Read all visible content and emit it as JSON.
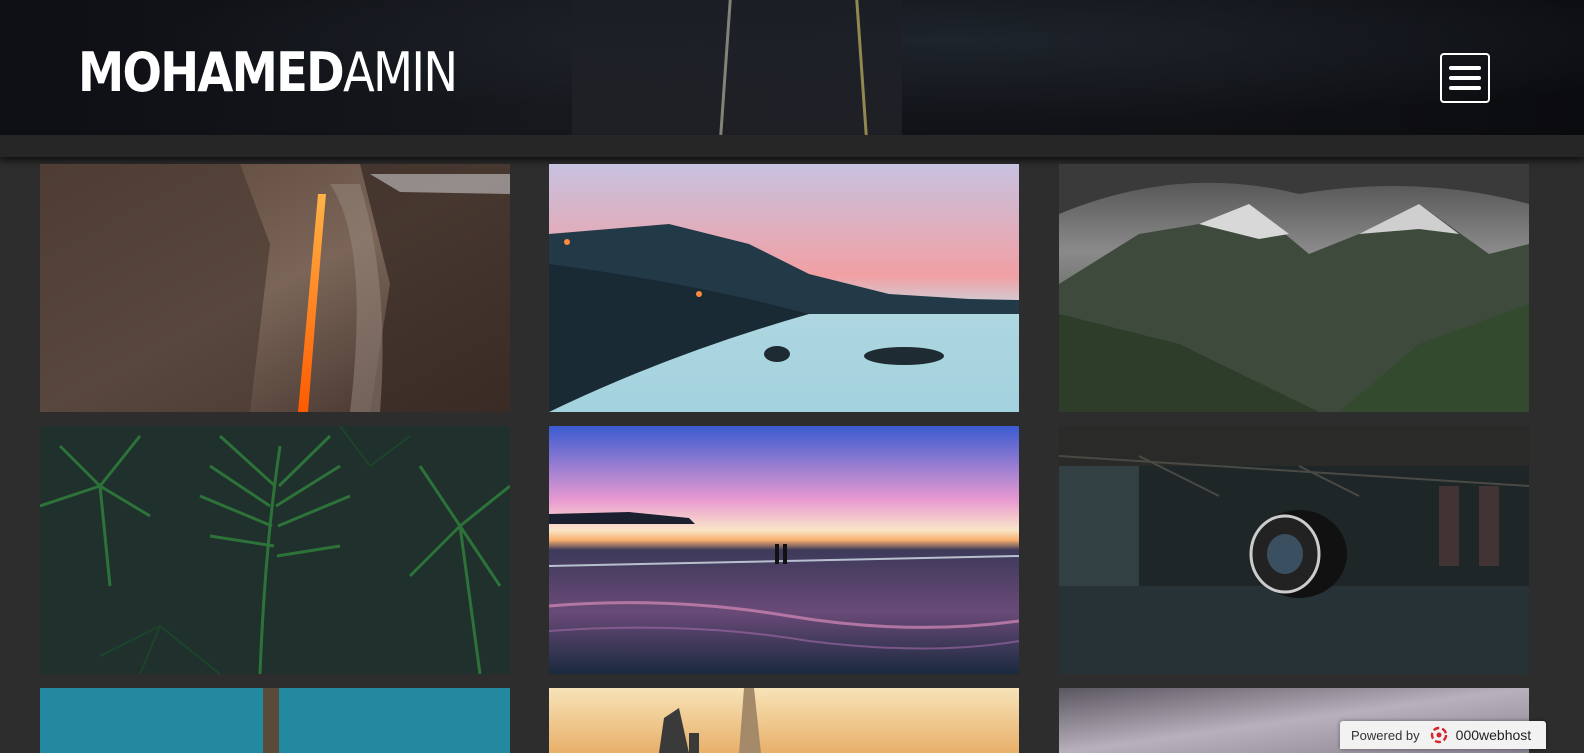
{
  "header": {
    "logo_bold": "MOHAMED",
    "logo_thin": "AMIN",
    "menu_icon": "hamburger-menu-icon"
  },
  "gallery": {
    "photos": [
      {
        "subject": "firefall-waterfall-cliff"
      },
      {
        "subject": "coastal-sunset-fog"
      },
      {
        "subject": "snowy-mountain-valley"
      },
      {
        "subject": "tropical-palm-leaves"
      },
      {
        "subject": "ocean-pool-sunset-couple"
      },
      {
        "subject": "camera-lens-warehouse"
      },
      {
        "subject": "aerial-ocean-pier"
      },
      {
        "subject": "city-skyscraper-sunset"
      },
      {
        "subject": "cloudy-sky"
      }
    ]
  },
  "badge": {
    "powered_by": "Powered by",
    "brand": "000webhost",
    "brand_icon": "000webhost-logo-icon"
  }
}
